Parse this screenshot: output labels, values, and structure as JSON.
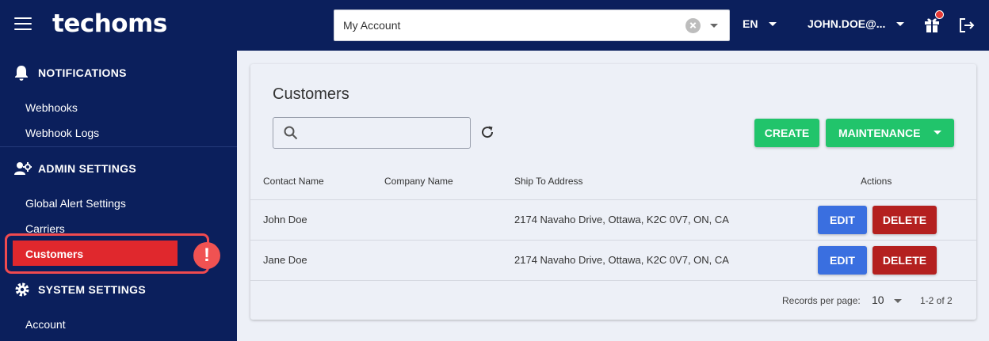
{
  "app": {
    "logo": "techoms"
  },
  "topbar": {
    "account_select": {
      "value": "My Account"
    },
    "language": "EN",
    "user": "JOHN.DOE@..."
  },
  "sidebar": {
    "notifications": {
      "label": "NOTIFICATIONS",
      "items": [
        "Webhooks",
        "Webhook Logs"
      ]
    },
    "admin_settings": {
      "label": "ADMIN SETTINGS",
      "items": [
        "Global Alert Settings",
        "Carriers",
        "Customers"
      ]
    },
    "system_settings": {
      "label": "SYSTEM SETTINGS",
      "items": [
        "Account"
      ]
    },
    "active_item": "Customers",
    "alert_badge": "!"
  },
  "page": {
    "title": "Customers",
    "search": {
      "value": "",
      "placeholder": ""
    },
    "buttons": {
      "create": "CREATE",
      "maintenance": "MAINTENANCE"
    },
    "table": {
      "columns": [
        "Contact Name",
        "Company Name",
        "Ship To Address",
        "Actions"
      ],
      "rows": [
        {
          "contact": "John Doe",
          "company": "",
          "address": "2174 Navaho Drive, Ottawa, K2C 0V7, ON, CA",
          "edit": "EDIT",
          "delete": "DELETE"
        },
        {
          "contact": "Jane Doe",
          "company": "",
          "address": "2174 Navaho Drive, Ottawa, K2C 0V7, ON, CA",
          "edit": "EDIT",
          "delete": "DELETE"
        }
      ]
    },
    "footer": {
      "records_label": "Records per page:",
      "records_value": "10",
      "range": "1-2 of 2"
    }
  },
  "colors": {
    "navy": "#0b1f5c",
    "green": "#21c46b",
    "blue": "#3a6fe0",
    "red": "#b4201f",
    "alert": "#e0282d"
  }
}
